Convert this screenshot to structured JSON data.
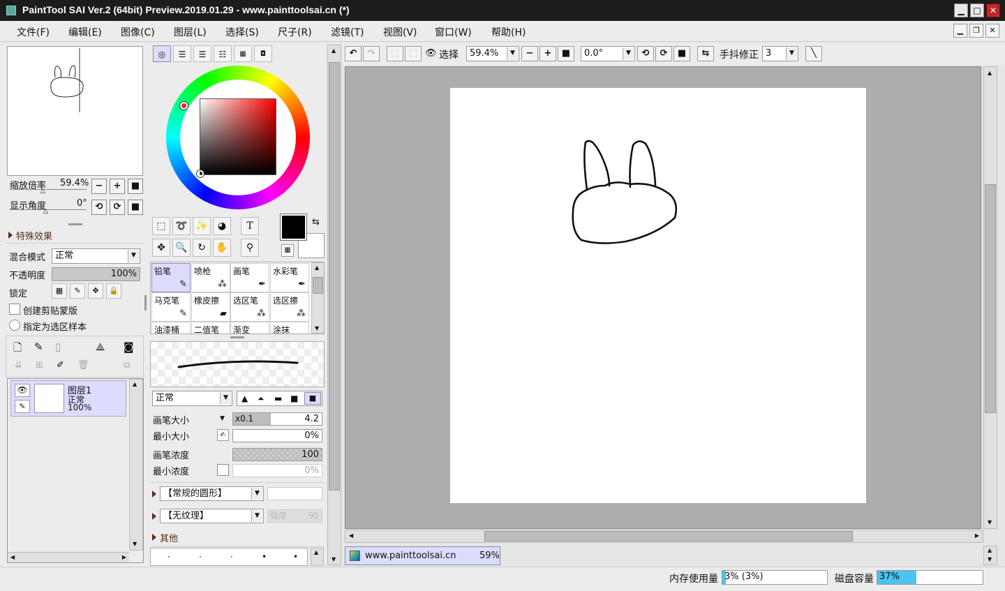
{
  "window": {
    "title": "PaintTool SAI Ver.2 (64bit) Preview.2019.01.29 - www.painttoolsai.cn (*)",
    "min": "▁",
    "max": "□",
    "close": "✕"
  },
  "menu": [
    "文件(F)",
    "编辑(E)",
    "图像(C)",
    "图层(L)",
    "选择(S)",
    "尺子(R)",
    "滤镜(T)",
    "视图(V)",
    "窗口(W)",
    "帮助(H)"
  ],
  "navigator": {
    "zoom_label": "缩放倍率",
    "zoom_value": "59.4%",
    "angle_label": "显示角度",
    "angle_value": "0°"
  },
  "layer_props": {
    "effects_label": "特殊效果",
    "blend_label": "混合模式",
    "blend_value": "正常",
    "opacity_label": "不透明度",
    "opacity_value": "100%",
    "lock_label": "锁定",
    "clip_label": "创建剪贴蒙版",
    "sample_label": "指定为选区样本"
  },
  "layers": [
    {
      "name": "图层1",
      "mode": "正常",
      "opacity": "100%"
    }
  ],
  "brushes": [
    {
      "label": "铅笔",
      "icon": "✎"
    },
    {
      "label": "喷枪",
      "icon": "⁂"
    },
    {
      "label": "画笔",
      "icon": "✒"
    },
    {
      "label": "水彩笔",
      "icon": "✒"
    },
    {
      "label": "马克笔",
      "icon": "✎"
    },
    {
      "label": "橡皮擦",
      "icon": "▰"
    },
    {
      "label": "选区笔",
      "icon": "⁂"
    },
    {
      "label": "选区擦",
      "icon": "⁂"
    },
    {
      "label": "油漆桶",
      "icon": ""
    },
    {
      "label": "二值笔",
      "icon": ""
    },
    {
      "label": "渐变",
      "icon": ""
    },
    {
      "label": "涂抹",
      "icon": ""
    }
  ],
  "brush_settings": {
    "mode_value": "正常",
    "size_label": "画笔大小",
    "size_mult": "x0.1",
    "size_value": "4.2",
    "min_size_label": "最小大小",
    "min_size_value": "0%",
    "density_label": "画笔浓度",
    "density_value": "100",
    "min_density_label": "最小浓度",
    "min_density_value": "0%",
    "shape_value": "【常规的圆形】",
    "texture_value": "【无纹理】",
    "strength_label": "强度",
    "strength_value": "95",
    "other_label": "其他"
  },
  "canvas_toolbar": {
    "select_label": "选择",
    "zoom_value": "59.4%",
    "angle_value": "0.0°",
    "stab_label": "手抖修正",
    "stab_value": "3"
  },
  "doc_tab": {
    "name": "www.painttoolsai.cn",
    "zoom": "59%"
  },
  "status": {
    "mem_label": "内存使用量",
    "mem_value": "3% (3%)",
    "mem_fraction": 0.03,
    "disk_label": "磁盘容量",
    "disk_value": "37%",
    "disk_fraction": 0.37
  },
  "colors": {
    "title_bg": "#1c1c1c",
    "selection": "#dcdcff",
    "progress": "#4ec2f0"
  }
}
